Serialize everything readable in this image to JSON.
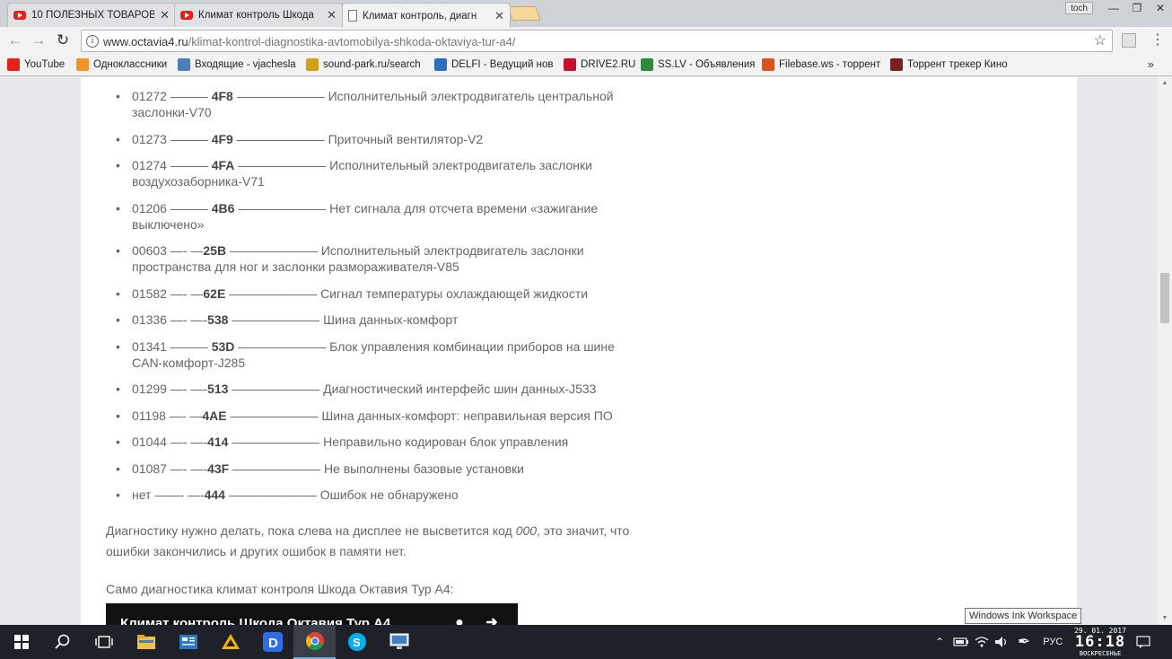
{
  "tabs": [
    {
      "label": "10 ПОЛЕЗНЫХ ТОВАРОВ",
      "close": "✕",
      "favicon": "youtube-icon"
    },
    {
      "label": "Климат контроль Шкода",
      "close": "✕",
      "favicon": "youtube-icon"
    },
    {
      "label": "Климат контроль, диагн",
      "close": "✕",
      "favicon": "document-icon",
      "active": true
    }
  ],
  "window": {
    "user": "toch",
    "minimize": "—",
    "restore": "❐",
    "close": "✕"
  },
  "toolbar": {
    "back": "←",
    "forward": "→",
    "reload": "↻",
    "url_host": "www.octavia4.ru",
    "url_path": "/klimat-kontrol-diagnostika-avtomobilya-shkoda-oktaviya-tur-a4/",
    "star": "☆",
    "menu": "⋮"
  },
  "bookmarks": [
    {
      "label": "YouTube",
      "color": "#e62117"
    },
    {
      "label": "Одноклассники",
      "color": "#f29423"
    },
    {
      "label": "Входящие - vjachesla",
      "color": "#4a7ebb"
    },
    {
      "label": "sound-park.ru/search",
      "color": "#d4a017"
    },
    {
      "label": "DELFI - Ведущий нов",
      "color": "#2b6fc0"
    },
    {
      "label": "DRIVE2.RU",
      "color": "#c8102e"
    },
    {
      "label": "SS.LV - Объявления",
      "color": "#2e8b3a"
    },
    {
      "label": "Filebase.ws - торрент",
      "color": "#d9531e"
    },
    {
      "label": "Торрент трекер Кино",
      "color": "#7a1f1f"
    }
  ],
  "bookmarks_more": "»",
  "article": {
    "codes": [
      {
        "num": "01272 ——— ",
        "hex": "4F8",
        "desc": " ——————— Исполнительный электродвигатель центральной заслонки-V70"
      },
      {
        "num": "01273 ——— ",
        "hex": "4F9",
        "desc": " ——————— Приточный вентилятор-V2"
      },
      {
        "num": "01274 ——— ",
        "hex": "4FA",
        "desc": " ——————— Исполнительный электродвигатель заслонки воздухозаборника-V71"
      },
      {
        "num": "01206 ——— ",
        "hex": "4B6",
        "desc": " ——————— Нет сигнала для отсчета времени «зажигание выключено»"
      },
      {
        "num": "00603 —- —",
        "hex": "25B",
        "desc": " ——————— Исполнительный электродвигатель заслонки пространства для ног и заслонки размораживателя-V85"
      },
      {
        "num": "01582 —- —",
        "hex": "62E",
        "desc": " ——————— Сигнал температуры охлаждающей жидкости"
      },
      {
        "num": "01336 —- —-",
        "hex": "538",
        "desc": " ——————— Шина данных-комфорт"
      },
      {
        "num": "01341 ——— ",
        "hex": "53D",
        "desc": " ——————— Блок управления комбинации приборов на шине CAN-комфорт-J285"
      },
      {
        "num": "01299 —- —-",
        "hex": "513",
        "desc": " ——————— Диагностический интерфейс шин данных-J533"
      },
      {
        "num": "01198 —- —",
        "hex": "4AE",
        "desc": " ——————— Шина данных-комфорт: неправильная версия ПО"
      },
      {
        "num": "01044 —- —-",
        "hex": "414",
        "desc": " ——————— Неправильно кодирован блок управления"
      },
      {
        "num": "01087 —- —-",
        "hex": "43F",
        "desc": " ——————— Не выполнены базовые установки"
      },
      {
        "num": "нет ——- —-",
        "hex": "444",
        "desc": " ——————— Ошибок не обнаружено"
      }
    ],
    "para1_a": "Диагностику нужно делать, пока слева на дисплее не высветится  код ",
    "para1_code": "000",
    "para1_b": ", это значит, что ошибки закончились и других ошибок в памяти нет.",
    "para2": "Само диагностика климат контроля Шкода Октавия Тур А4:",
    "video_title": "Климат контроль Шкода Октавия Тур А4"
  },
  "tooltip": "Windows Ink Workspace",
  "taskbar": {
    "lang": "РУС",
    "date": "29. 01. 2017",
    "time": "16:18",
    "weekday": "ВОСКРЕСЕНЬЕ"
  }
}
